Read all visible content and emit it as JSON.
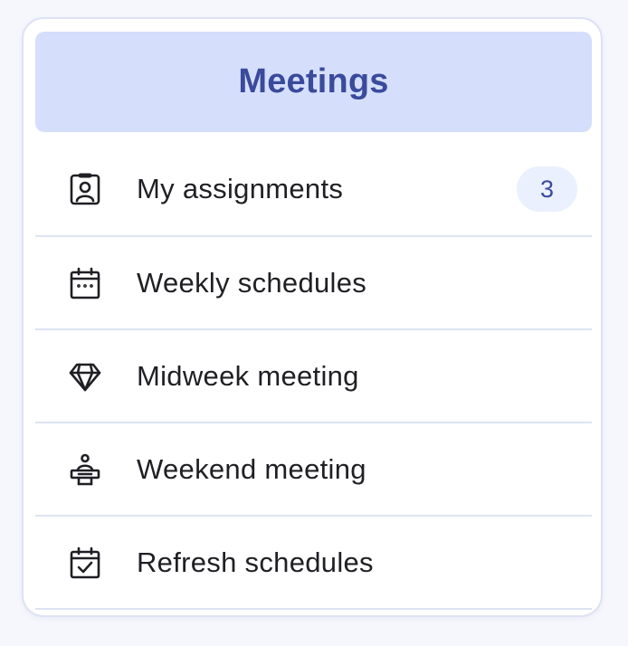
{
  "header": {
    "title": "Meetings"
  },
  "menu": {
    "items": [
      {
        "label": "My assignments",
        "icon": "assignment-badge-icon",
        "badge": "3"
      },
      {
        "label": "Weekly schedules",
        "icon": "calendar-icon"
      },
      {
        "label": "Midweek meeting",
        "icon": "diamond-icon"
      },
      {
        "label": "Weekend meeting",
        "icon": "speaker-podium-icon"
      },
      {
        "label": "Refresh schedules",
        "icon": "calendar-check-icon"
      }
    ]
  },
  "colors": {
    "header_bg": "#d5dffb",
    "header_text": "#3a4a9c",
    "badge_bg": "#eaf0fd",
    "divider": "#dce4f4"
  }
}
